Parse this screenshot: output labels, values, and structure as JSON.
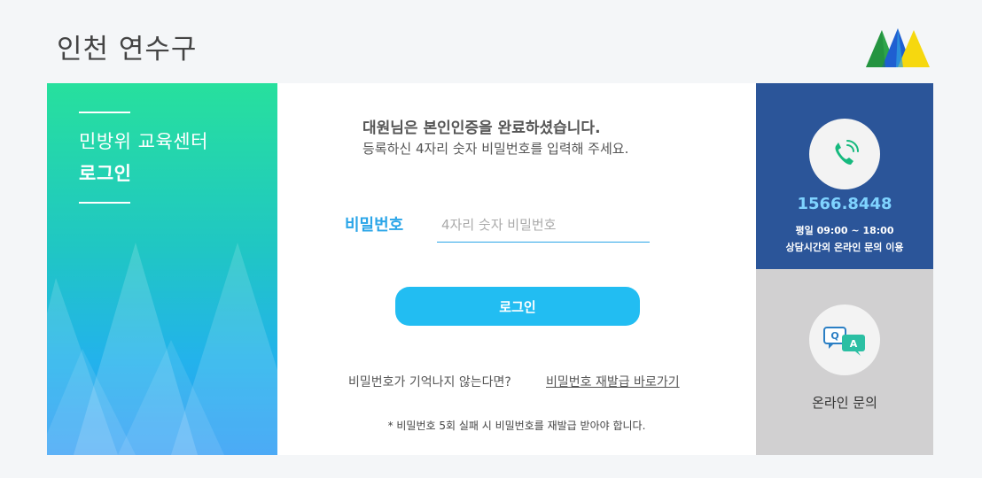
{
  "header": {
    "site_title": "인천 연수구",
    "logo_icon": "yeonsu-mountain-logo"
  },
  "left_panel": {
    "title_line1": "민방위 교육센터",
    "title_line2": "로그인"
  },
  "form": {
    "message_line1": "대원님은 본인인증을 완료하셨습니다.",
    "message_line2": "등록하신 4자리 숫자 비밀번호를 입력해 주세요.",
    "password_label": "비밀번호",
    "password_placeholder": "4자리 숫자 비밀번호",
    "password_value": "",
    "login_button": "로그인",
    "forgot_text": "비밀번호가 기억나지 않는다면?",
    "reset_link": "비밀번호 재발급 바로가기",
    "notice": "* 비밀번호 5회 실패 시 비밀번호를 재발급 받아야 합니다."
  },
  "contact": {
    "icon": "phone-icon",
    "phone": "1566.8448",
    "hours": "평일 09:00 ~ 18:00",
    "after_hours": "상담시간외 온라인 문의 이용"
  },
  "inquiry": {
    "icon": "qa-chat-icon",
    "label": "온라인 문의"
  },
  "colors": {
    "accent": "#22bdf2",
    "contact_bg": "#2b5599",
    "phone_text": "#7fd3ff",
    "inquiry_bg": "#d1d0d1"
  }
}
